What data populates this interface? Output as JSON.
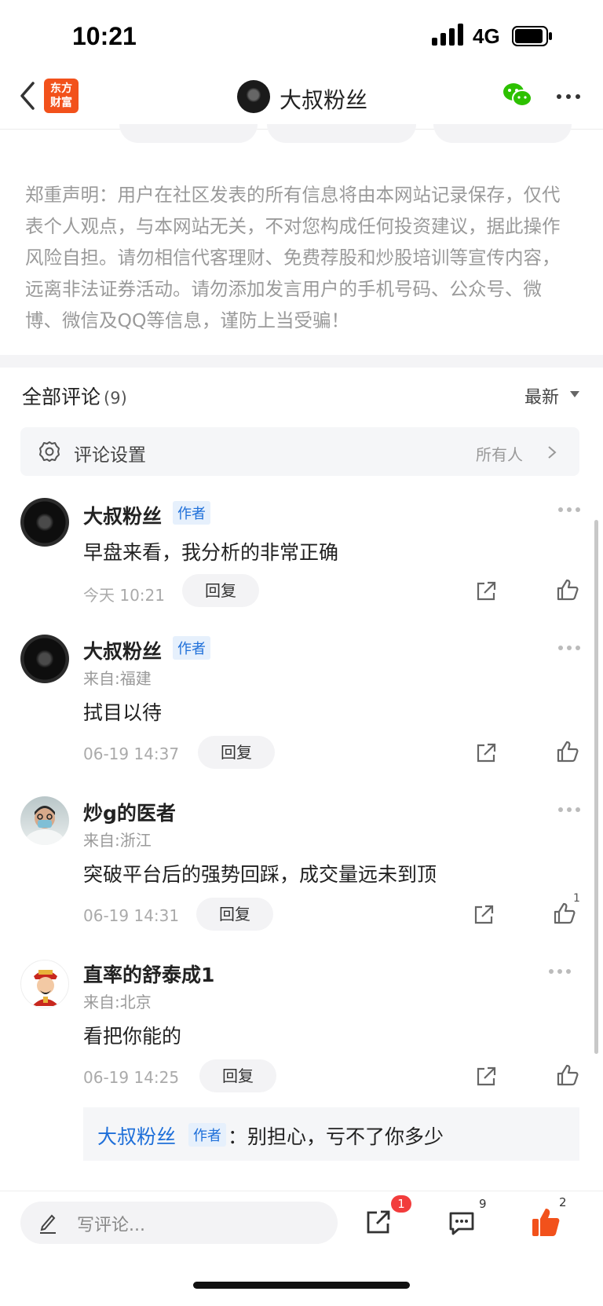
{
  "status_bar": {
    "time": "10:21",
    "network": "4G"
  },
  "nav": {
    "logo_text_line1": "东方",
    "logo_text_line2": "财富",
    "title": "大叔粉丝"
  },
  "disclaimer": "郑重声明：用户在社区发表的所有信息将由本网站记录保存，仅代表个人观点，与本网站无关，不对您构成任何投资建议，据此操作风险自担。请勿相信代客理财、免费荐股和炒股培训等宣传内容，远离非法证券活动。请勿添加发言用户的手机号码、公众号、微博、微信及QQ等信息，谨防上当受骗！",
  "comments_header": {
    "title": "全部评论",
    "count": "(9)",
    "sort": "最新"
  },
  "comment_settings": {
    "label": "评论设置",
    "value": "所有人"
  },
  "comments": [
    {
      "user": "大叔粉丝",
      "badge": "作者",
      "location": "",
      "text": "早盘来看，我分析的非常正确",
      "time": "今天 10:21",
      "reply": "回复",
      "likes": ""
    },
    {
      "user": "大叔粉丝",
      "badge": "作者",
      "location": "来自:福建",
      "text": "拭目以待",
      "time": "06-19 14:37",
      "reply": "回复",
      "likes": ""
    },
    {
      "user": "炒g的医者",
      "badge": "",
      "location": "来自:浙江",
      "text": "突破平台后的强势回踩，成交量远未到顶",
      "time": "06-19 14:31",
      "reply": "回复",
      "likes": "1"
    },
    {
      "user": "直率的舒泰成1",
      "badge": "",
      "location": "来自:北京",
      "text": "看把你能的",
      "time": "06-19 14:25",
      "reply": "回复",
      "likes": ""
    }
  ],
  "sub_reply": {
    "user": "大叔粉丝",
    "badge": "作者",
    "text": "：别担心，亏不了你多少"
  },
  "bottom_bar": {
    "input_placeholder": "写评论...",
    "share_badge": "1",
    "comment_count": "9",
    "like_count": "2"
  },
  "colors": {
    "accent_blue": "#1e6fd9",
    "like_orange": "#f2511b",
    "badge_red": "#f23c3c"
  },
  "icons": [
    "back-icon",
    "wechat-icon",
    "more-icon",
    "gear-icon",
    "chevron-right-icon",
    "share-icon",
    "thumbs-up-icon",
    "pencil-icon",
    "comment-icon"
  ]
}
